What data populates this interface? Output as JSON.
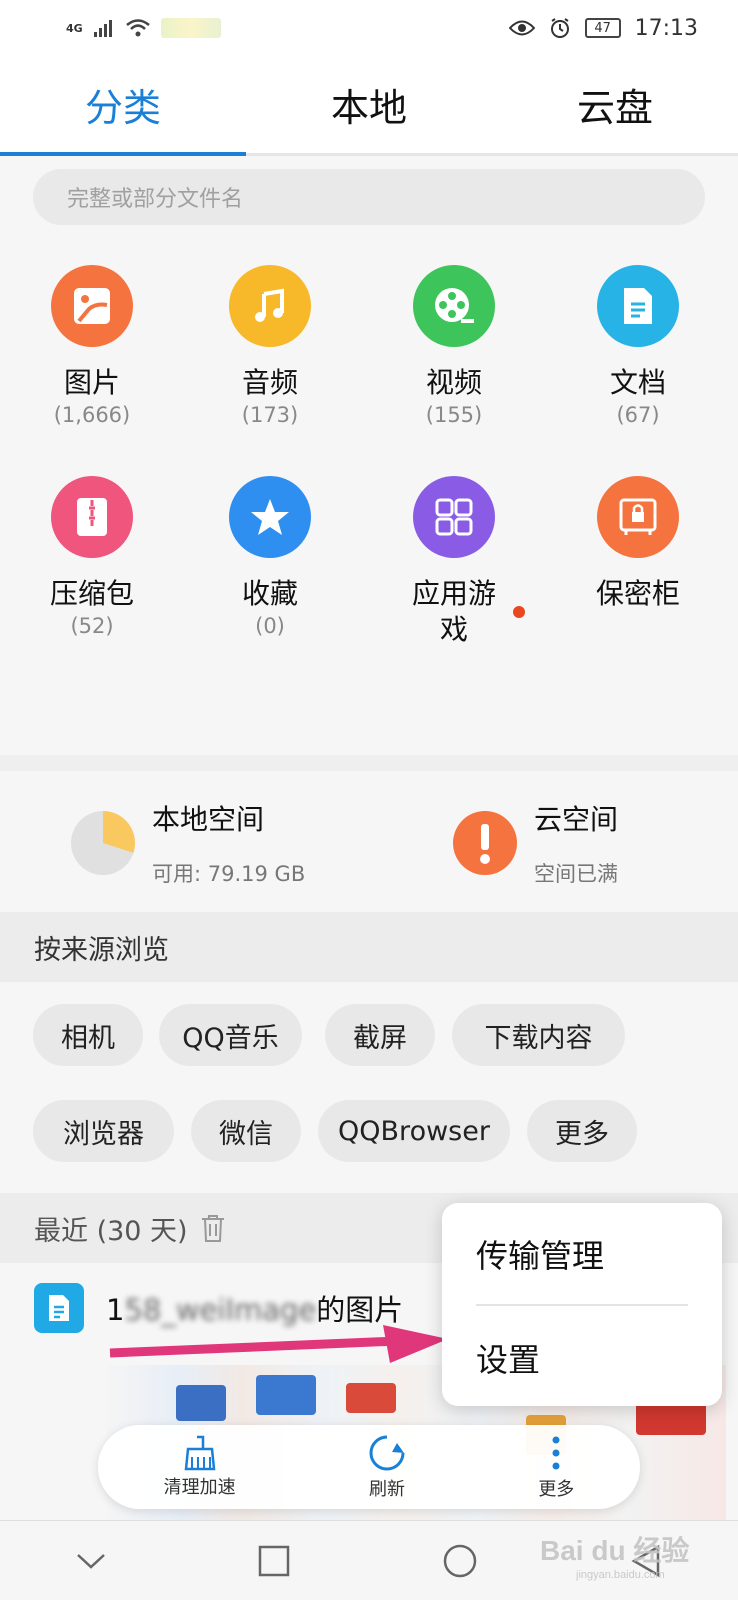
{
  "status": {
    "network": "4G",
    "battery": "47",
    "time": "17:13"
  },
  "tabs": [
    "分类",
    "本地",
    "云盘"
  ],
  "search": {
    "placeholder": "完整或部分文件名"
  },
  "categories": [
    {
      "label": "图片",
      "count": "(1,666)",
      "color": "#f4733f",
      "icon": "image-icon"
    },
    {
      "label": "音频",
      "count": "(173)",
      "color": "#f7b82a",
      "icon": "music-icon"
    },
    {
      "label": "视频",
      "count": "(155)",
      "color": "#3dc45a",
      "icon": "video-reel-icon"
    },
    {
      "label": "文档",
      "count": "(67)",
      "color": "#27b3e6",
      "icon": "document-icon"
    },
    {
      "label": "压缩包",
      "count": "(52)",
      "color": "#f0557e",
      "icon": "zip-icon"
    },
    {
      "label": "收藏",
      "count": "(0)",
      "color": "#2f8ff1",
      "icon": "star-icon"
    },
    {
      "label": "应用游戏",
      "label_line2": "戏",
      "count": "",
      "color": "#8a5ce6",
      "icon": "apps-grid-icon"
    },
    {
      "label": "保密柜",
      "count": "",
      "color": "#f4733f",
      "icon": "safe-icon"
    }
  ],
  "storage": {
    "local": {
      "title": "本地空间",
      "sub": "可用: 79.19 GB",
      "used_fraction": 0.7
    },
    "cloud": {
      "title": "云空间",
      "sub": "空间已满"
    }
  },
  "browse": {
    "header": "按来源浏览",
    "chips": [
      "相机",
      "QQ音乐",
      "截屏",
      "下载内容",
      "浏览器",
      "微信",
      "QQBrowser",
      "更多"
    ]
  },
  "recent": {
    "header": "最近 (30 天)",
    "item_name_prefix": "1",
    "item_name_blurred": "58_weiImage",
    "item_name_suffix": "的图片"
  },
  "popup": {
    "items": [
      "传输管理",
      "设置"
    ]
  },
  "toolbar": {
    "items": [
      "清理加速",
      "刷新",
      "更多"
    ]
  },
  "watermark": {
    "brand": "Bai du 经验",
    "url": "jingyan.baidu.com"
  },
  "colors": {
    "accent": "#1a7fd6",
    "arrow": "#e0367a"
  }
}
